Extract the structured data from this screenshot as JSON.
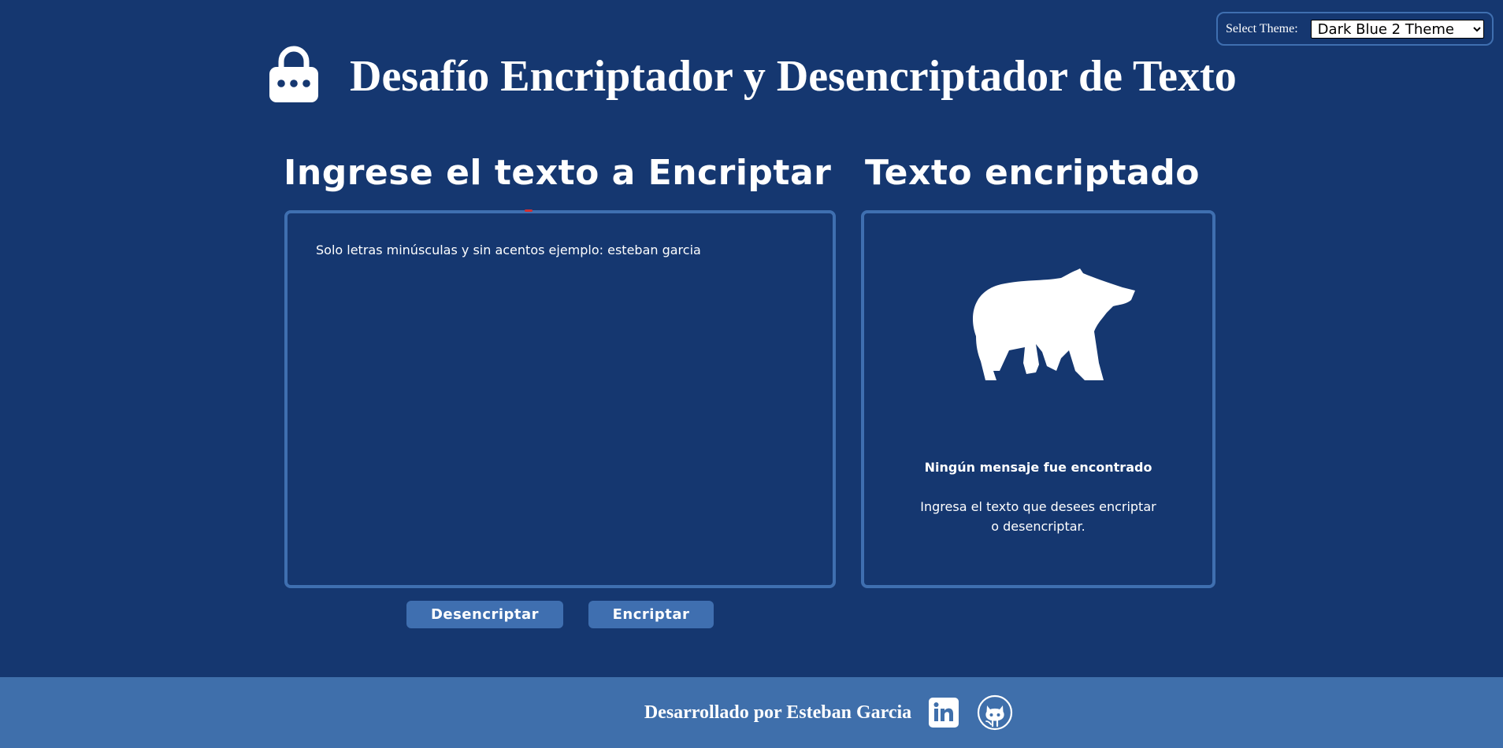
{
  "theme": {
    "label": "Select Theme:",
    "selected": "Dark Blue 2 Theme",
    "options": [
      "Dark Blue 2 Theme"
    ]
  },
  "header": {
    "title": "Desafío Encriptador y Desencriptador de Texto",
    "icon": "lock-icon"
  },
  "input_section": {
    "heading": "Ingrese el texto a Encriptar",
    "placeholder": "Solo letras minúsculas y sin acentos ejemplo: esteban garcia",
    "value": ""
  },
  "output_section": {
    "heading": "Texto encriptado",
    "icon": "bear-icon",
    "empty_title": "Ningún mensaje fue encontrado",
    "empty_description": "Ingresa el texto que desees encriptar o desencriptar."
  },
  "buttons": {
    "decrypt_label": "Desencriptar",
    "encrypt_label": "Encriptar"
  },
  "footer": {
    "text": "Desarrollado por Esteban Garcia",
    "icons": [
      "linkedin-icon",
      "github-icon"
    ]
  },
  "colors": {
    "background": "#153770",
    "accent": "#3f6fb0",
    "footer": "#3f6fab",
    "text": "#ffffff"
  }
}
